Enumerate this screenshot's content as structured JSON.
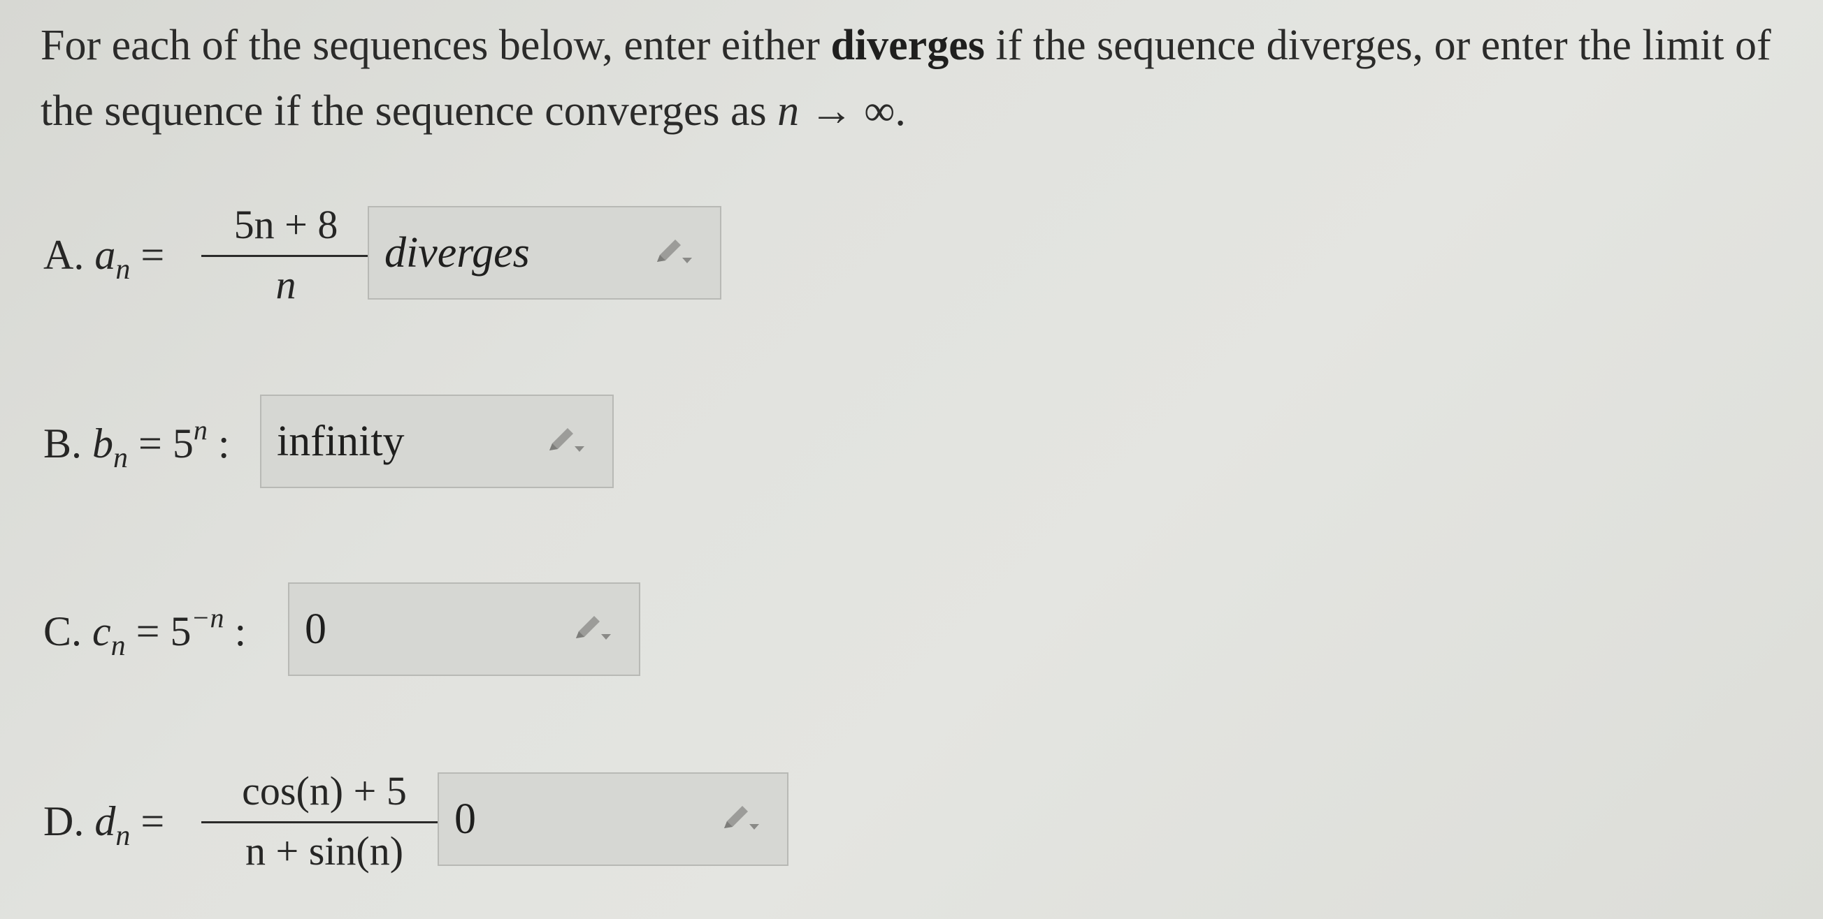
{
  "prompt": {
    "part1": "For each of the sequences below, enter either ",
    "bold": "diverges",
    "part2": " if the sequence diverges, or enter the limit of the sequence if the sequence converges as ",
    "var": "n",
    "arrow": " → ∞",
    "end": "."
  },
  "problems": [
    {
      "letter": "A.",
      "seq": "a",
      "sub": "n",
      "equals": "=",
      "numerator": "5n + 8",
      "denominator": "n",
      "colon": ":",
      "answer": "diverges"
    },
    {
      "letter": "B.",
      "seq": "b",
      "sub": "n",
      "rhs_base": "= 5",
      "rhs_exp": "n",
      "colon": ":",
      "answer": "infinity"
    },
    {
      "letter": "C.",
      "seq": "c",
      "sub": "n",
      "rhs_base": "= 5",
      "rhs_exp": "−n",
      "colon": ":",
      "answer": "0"
    },
    {
      "letter": "D.",
      "seq": "d",
      "sub": "n",
      "equals": "=",
      "numerator": "cos(n) + 5",
      "denominator": "n + sin(n)",
      "colon": ":",
      "answer": "0"
    }
  ],
  "icons": {
    "edit": "pencil-dropdown-icon"
  }
}
